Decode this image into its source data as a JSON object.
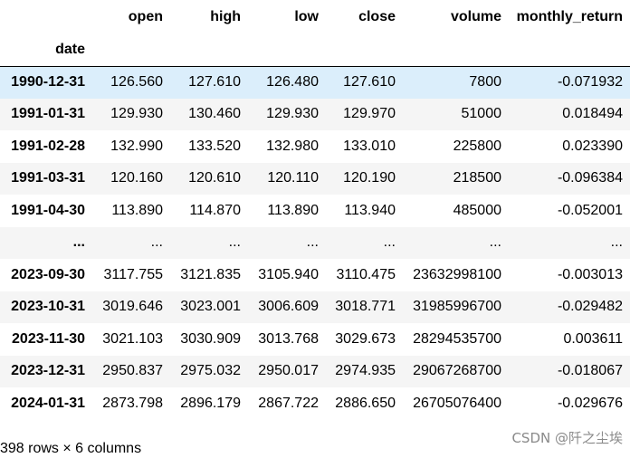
{
  "columns": [
    "open",
    "high",
    "low",
    "close",
    "volume",
    "monthly_return"
  ],
  "index_name": "date",
  "rows": [
    {
      "date": "1990-12-31",
      "open": "126.560",
      "high": "127.610",
      "low": "126.480",
      "close": "127.610",
      "volume": "7800",
      "monthly_return": "-0.071932"
    },
    {
      "date": "1991-01-31",
      "open": "129.930",
      "high": "130.460",
      "low": "129.930",
      "close": "129.970",
      "volume": "51000",
      "monthly_return": "0.018494"
    },
    {
      "date": "1991-02-28",
      "open": "132.990",
      "high": "133.520",
      "low": "132.980",
      "close": "133.010",
      "volume": "225800",
      "monthly_return": "0.023390"
    },
    {
      "date": "1991-03-31",
      "open": "120.160",
      "high": "120.610",
      "low": "120.110",
      "close": "120.190",
      "volume": "218500",
      "monthly_return": "-0.096384"
    },
    {
      "date": "1991-04-30",
      "open": "113.890",
      "high": "114.870",
      "low": "113.890",
      "close": "113.940",
      "volume": "485000",
      "monthly_return": "-0.052001"
    },
    {
      "date": "...",
      "open": "...",
      "high": "...",
      "low": "...",
      "close": "...",
      "volume": "...",
      "monthly_return": "..."
    },
    {
      "date": "2023-09-30",
      "open": "3117.755",
      "high": "3121.835",
      "low": "3105.940",
      "close": "3110.475",
      "volume": "23632998100",
      "monthly_return": "-0.003013"
    },
    {
      "date": "2023-10-31",
      "open": "3019.646",
      "high": "3023.001",
      "low": "3006.609",
      "close": "3018.771",
      "volume": "31985996700",
      "monthly_return": "-0.029482"
    },
    {
      "date": "2023-11-30",
      "open": "3021.103",
      "high": "3030.909",
      "low": "3013.768",
      "close": "3029.673",
      "volume": "28294535700",
      "monthly_return": "0.003611"
    },
    {
      "date": "2023-12-31",
      "open": "2950.837",
      "high": "2975.032",
      "low": "2950.017",
      "close": "2974.935",
      "volume": "29067268700",
      "monthly_return": "-0.018067"
    },
    {
      "date": "2024-01-31",
      "open": "2873.798",
      "high": "2896.179",
      "low": "2867.722",
      "close": "2886.650",
      "volume": "26705076400",
      "monthly_return": "-0.029676"
    }
  ],
  "highlighted_row": 0,
  "footer": "398 rows × 6 columns",
  "watermark": "CSDN @阡之尘埃",
  "colors": {
    "highlight": "#dbeefb",
    "stripe": "#f5f5f5",
    "watermark": "#8a8a8a"
  }
}
